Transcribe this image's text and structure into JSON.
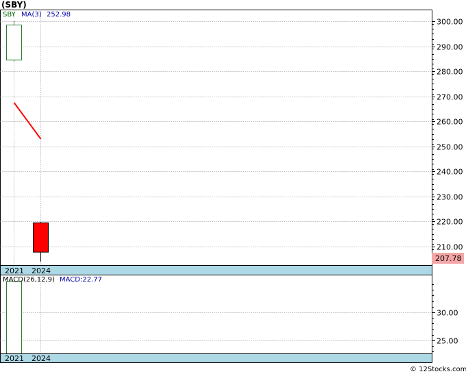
{
  "header": {
    "symbol": "(SBY)"
  },
  "price_legend": {
    "symbol": "SBY",
    "ma_label": "MA(3)",
    "ma_value": "252.98"
  },
  "macd_legend": {
    "label": "MACD(26,12,9)",
    "value": "MACD:22.77"
  },
  "last_price_label": "207.78",
  "footer": {
    "source": "© 12Stocks.com"
  },
  "colors": {
    "up_candle": "#2e7d32",
    "down_candle": "#ff0000",
    "ma_line": "#ff0000",
    "axis_band": "#add8e6",
    "last_price_bg": "#f4a6a6",
    "legend_text": "#0000aa",
    "symbol_text": "#006400"
  },
  "chart_data": [
    {
      "type": "candlestick",
      "panel": "price",
      "categories": [
        "2021",
        "2024"
      ],
      "candles": [
        {
          "x": "2021",
          "open": 284.5,
          "close": 298.5,
          "high": 300.0,
          "low": 284.0,
          "direction": "up"
        },
        {
          "x": "2024",
          "open": 219.5,
          "close": 207.78,
          "high": 219.8,
          "low": 204.0,
          "direction": "down"
        }
      ],
      "series": [
        {
          "name": "MA(3)",
          "x": [
            "2021",
            "2024"
          ],
          "values": [
            267.5,
            253.0
          ]
        }
      ],
      "y_ticks": [
        210,
        220,
        230,
        240,
        250,
        260,
        270,
        280,
        290,
        300
      ],
      "y_tick_labels": [
        "210.00",
        "220.00",
        "230.00",
        "240.00",
        "250.00",
        "260.00",
        "270.00",
        "280.00",
        "290.00",
        "300.00"
      ],
      "ylim": [
        204,
        302
      ],
      "grid": true
    },
    {
      "type": "bar",
      "panel": "macd",
      "categories": [
        "2021",
        "2024"
      ],
      "series": [
        {
          "name": "MACD",
          "values": [
            35.5,
            null
          ]
        }
      ],
      "y_ticks": [
        25,
        30
      ],
      "y_tick_labels": [
        "25.00",
        "30.00"
      ],
      "ylim": [
        22.77,
        35.5
      ],
      "grid": true
    }
  ]
}
